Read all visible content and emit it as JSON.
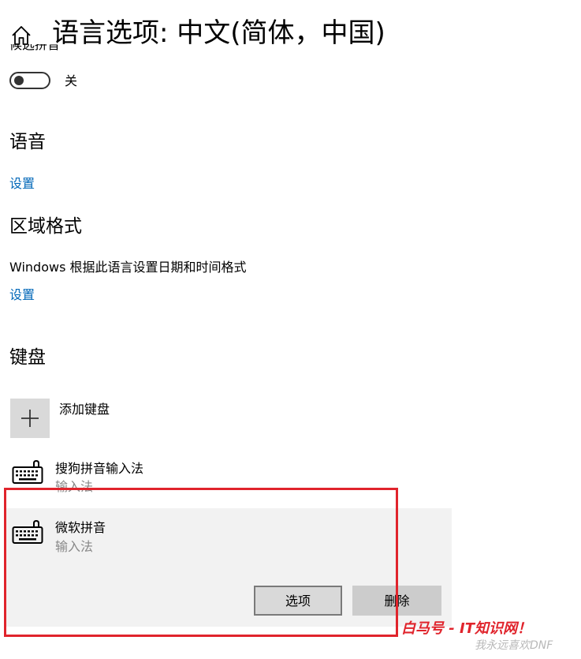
{
  "header": {
    "title": "语言选项: 中文(简体，中国)",
    "home_icon": "home-icon"
  },
  "partial_label": "候选拼音",
  "toggle": {
    "state_label": "关",
    "on": false
  },
  "speech": {
    "heading": "语音",
    "settings_link": "设置"
  },
  "region": {
    "heading": "区域格式",
    "description": "Windows 根据此语言设置日期和时间格式",
    "settings_link": "设置"
  },
  "keyboard": {
    "heading": "键盘",
    "add_label": "添加键盘",
    "add_icon": "plus-icon",
    "items": [
      {
        "title": "搜狗拼音输入法",
        "subtitle": "输入法",
        "icon": "keyboard-icon"
      },
      {
        "title": "微软拼音",
        "subtitle": "输入法",
        "icon": "keyboard-icon"
      }
    ],
    "options_label": "选项",
    "remove_label": "删除"
  },
  "watermark": {
    "main": "白马号 - IT知识网！",
    "sub": "我永远喜欢DNF"
  },
  "colors": {
    "link": "#0067b8",
    "highlight": "#e0242c",
    "selected_bg": "#f2f2f2",
    "button_bg": "#d9d9d9"
  }
}
